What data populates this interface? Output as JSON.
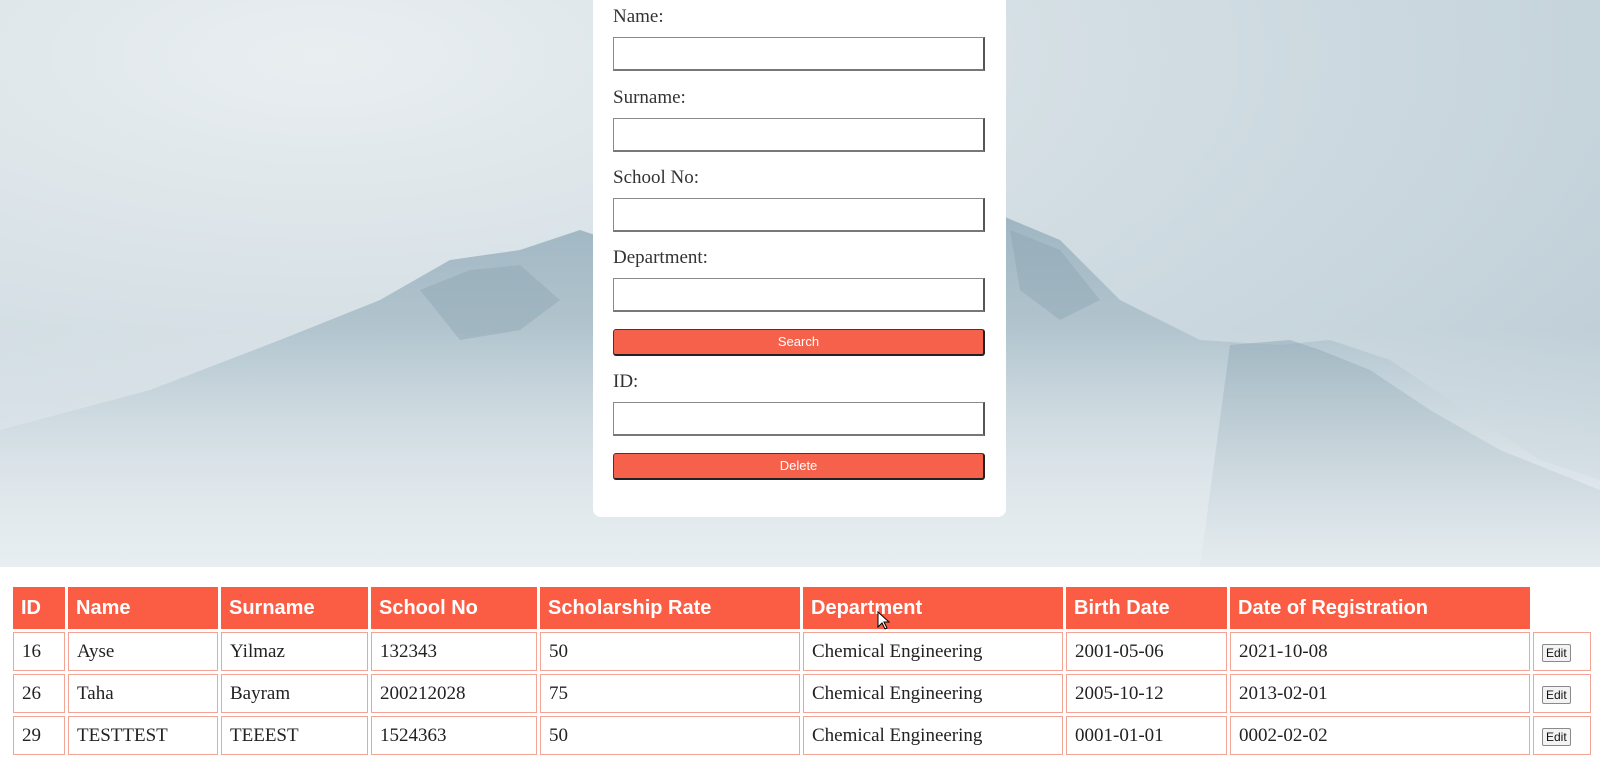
{
  "form": {
    "name_label": "Name:",
    "surname_label": "Surname:",
    "school_no_label": "School No:",
    "department_label": "Department:",
    "search_button": "Search",
    "id_label": "ID:",
    "delete_button": "Delete",
    "name_value": "",
    "surname_value": "",
    "school_no_value": "",
    "department_value": "",
    "id_value": ""
  },
  "table": {
    "headers": [
      "ID",
      "Name",
      "Surname",
      "School No",
      "Scholarship Rate",
      "Department",
      "Birth Date",
      "Date of Registration"
    ],
    "edit_label": "Edit",
    "rows": [
      [
        "16",
        "Ayse",
        "Yilmaz",
        "132343",
        "50",
        "Chemical Engineering",
        "2001-05-06",
        "2021-10-08"
      ],
      [
        "26",
        "Taha",
        "Bayram",
        "200212028",
        "75",
        "Chemical Engineering",
        "2005-10-12",
        "2013-02-01"
      ],
      [
        "29",
        "TESTTEST",
        "TEEEST",
        "1524363",
        "50",
        "Chemical Engineering",
        "0001-01-01",
        "0002-02-02"
      ]
    ]
  },
  "colors": {
    "accent": "#fb5c44",
    "cell_border": "#f2a497"
  }
}
